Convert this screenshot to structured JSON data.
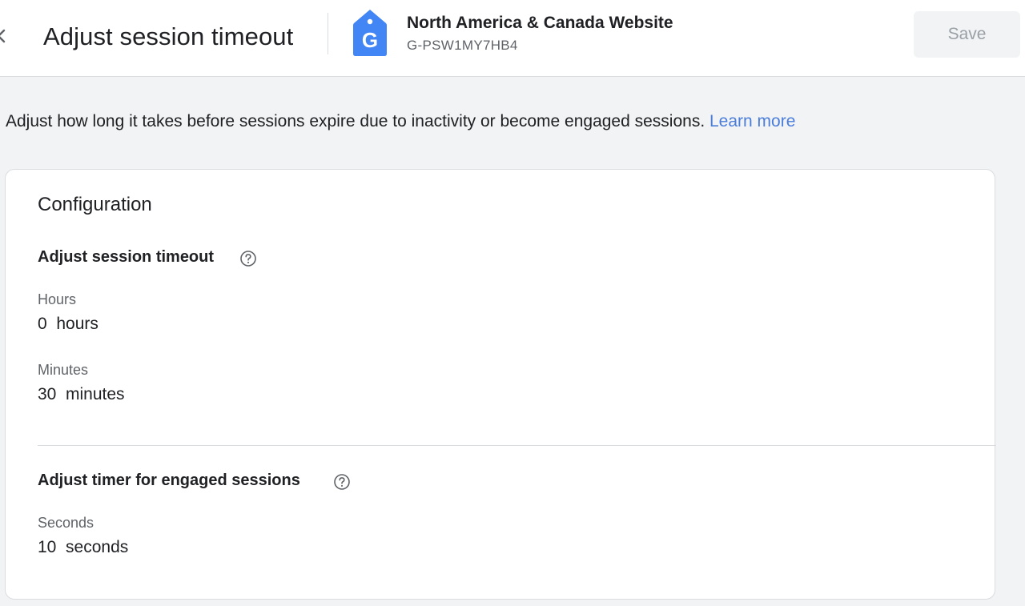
{
  "header": {
    "title": "Adjust session timeout",
    "property_name": "North America & Canada Website",
    "property_id": "G-PSW1MY7HB4",
    "property_icon": "google-analytics-tag-icon",
    "save_label": "Save",
    "accent_color": "#4285f4"
  },
  "intro": {
    "text": "Adjust how long it takes before sessions expire due to inactivity or become engaged sessions. ",
    "link_label": "Learn more"
  },
  "configuration": {
    "title": "Configuration",
    "session_timeout": {
      "title": "Adjust session timeout",
      "hours_label": "Hours",
      "hours_value": "0  hours",
      "minutes_label": "Minutes",
      "minutes_value": "30  minutes"
    },
    "engaged_sessions": {
      "title": "Adjust timer for engaged sessions",
      "seconds_label": "Seconds",
      "seconds_value": "10  seconds"
    }
  }
}
